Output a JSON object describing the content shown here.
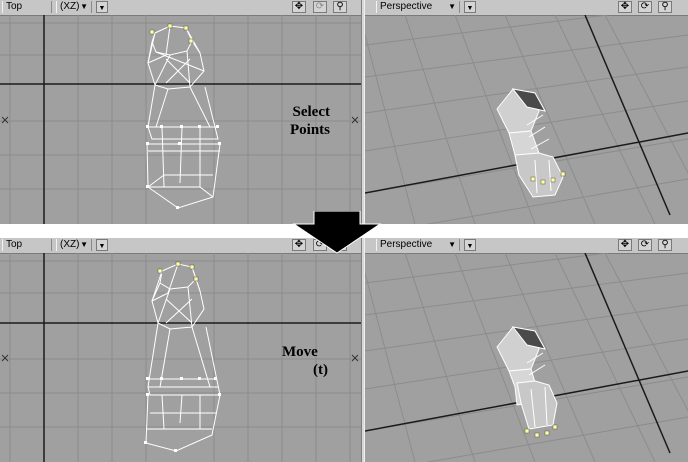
{
  "steps": [
    {
      "left_view": {
        "view_label": "Top",
        "axes_label": "(XZ)"
      },
      "right_view": {
        "view_label": "Perspective"
      },
      "caption": {
        "line1": "Select",
        "line2": "Points"
      }
    },
    {
      "left_view": {
        "view_label": "Top",
        "axes_label": "(XZ)"
      },
      "right_view": {
        "view_label": "Perspective"
      },
      "caption": {
        "line1": "Move",
        "line2": "(t)"
      }
    }
  ],
  "icons": {
    "move_view": "move-arrows-icon",
    "rotate_view": "rotate-icon",
    "zoom_view": "magnifier-icon",
    "step_arrow": "down-arrow-icon"
  },
  "colors": {
    "viewport_bg": "#a0a0a0",
    "grid_line": "#8c8c8c",
    "axis_line": "#1a1a1a",
    "wire": "#ffffff",
    "selected_point": "#ffffa0"
  }
}
